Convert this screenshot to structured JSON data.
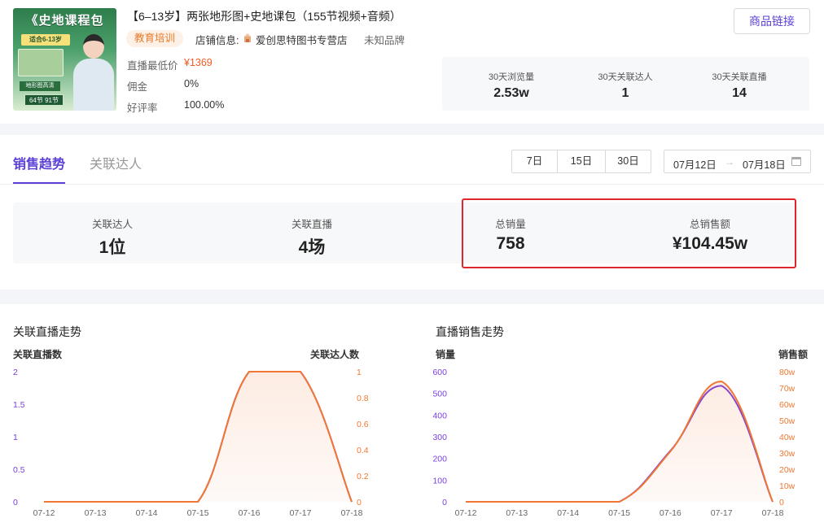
{
  "product": {
    "image": {
      "title": "《史地课程包",
      "subtitle": "适合6-13岁",
      "tag_a": "地形图高清",
      "tag_b": "64节 91节"
    },
    "title": "【6–13岁】两张地形图+史地课包（155节视频+音频）",
    "category_badge": "教育培训",
    "shop_label": "店铺信息:",
    "shop_name": "爱创思特图书专营店",
    "brand": "未知品牌",
    "details": [
      {
        "label": "直播最低价",
        "value": "¥1369"
      },
      {
        "label": "佣金",
        "value": "0%"
      },
      {
        "label": "好评率",
        "value": "100.00%"
      }
    ],
    "link_button": "商品链接"
  },
  "stats_30d": [
    {
      "label": "30天浏览量",
      "value": "2.53w"
    },
    {
      "label": "30天关联达人",
      "value": "1"
    },
    {
      "label": "30天关联直播",
      "value": "14"
    }
  ],
  "tabs": [
    {
      "label": "销售趋势",
      "active": true
    },
    {
      "label": "关联达人",
      "active": false
    }
  ],
  "range_buttons": [
    "7日",
    "15日",
    "30日"
  ],
  "date_range": {
    "start": "07月12日",
    "arrow": "→",
    "end": "07月18日"
  },
  "metrics": [
    {
      "label": "关联达人",
      "value": "1位"
    },
    {
      "label": "关联直播",
      "value": "4场"
    },
    {
      "label": "总销量",
      "value": "758"
    },
    {
      "label": "总销售额",
      "value": "¥104.45w"
    }
  ],
  "colors": {
    "accent": "#5b3fd6",
    "purple_series": "#7a3fe0",
    "orange_series": "#f07834",
    "highlight": "#e0262d",
    "price": "#ee5a24"
  },
  "chart_data": [
    {
      "type": "line",
      "title": "关联直播走势",
      "ylabel_left": "关联直播数",
      "ylabel_right": "关联达人数",
      "x": [
        "07-12",
        "07-13",
        "07-14",
        "07-15",
        "07-16",
        "07-17",
        "07-18"
      ],
      "yticks_left": [
        "0",
        "0.5",
        "1",
        "1.5",
        "2"
      ],
      "yticks_right": [
        "0",
        "0.2",
        "0.4",
        "0.6",
        "0.8",
        "1"
      ],
      "ylim_left": [
        0,
        2
      ],
      "ylim_right": [
        0,
        1
      ],
      "series": [
        {
          "axis": "left",
          "color": "#7a3fe0",
          "values": [
            0,
            0,
            0,
            0,
            2,
            2,
            0
          ]
        },
        {
          "axis": "right",
          "color": "#f07834",
          "values": [
            0,
            0,
            0,
            0,
            1,
            1,
            0
          ]
        }
      ]
    },
    {
      "type": "line",
      "title": "直播销售走势",
      "ylabel_left": "销量",
      "ylabel_right": "销售额",
      "x": [
        "07-12",
        "07-13",
        "07-14",
        "07-15",
        "07-16",
        "07-17",
        "07-18"
      ],
      "yticks_left": [
        "0",
        "100",
        "200",
        "300",
        "400",
        "500",
        "600"
      ],
      "yticks_right": [
        "0",
        "10w",
        "20w",
        "30w",
        "40w",
        "50w",
        "60w",
        "70w",
        "80w"
      ],
      "ylim_left": [
        0,
        600
      ],
      "ylim_right": [
        0,
        80
      ],
      "series": [
        {
          "axis": "left",
          "color": "#7a3fe0",
          "values": [
            0,
            0,
            0,
            0,
            235,
            535,
            0
          ]
        },
        {
          "axis": "right",
          "color": "#f07834",
          "values": [
            0,
            0,
            0,
            0,
            31,
            74,
            0
          ]
        }
      ]
    }
  ]
}
